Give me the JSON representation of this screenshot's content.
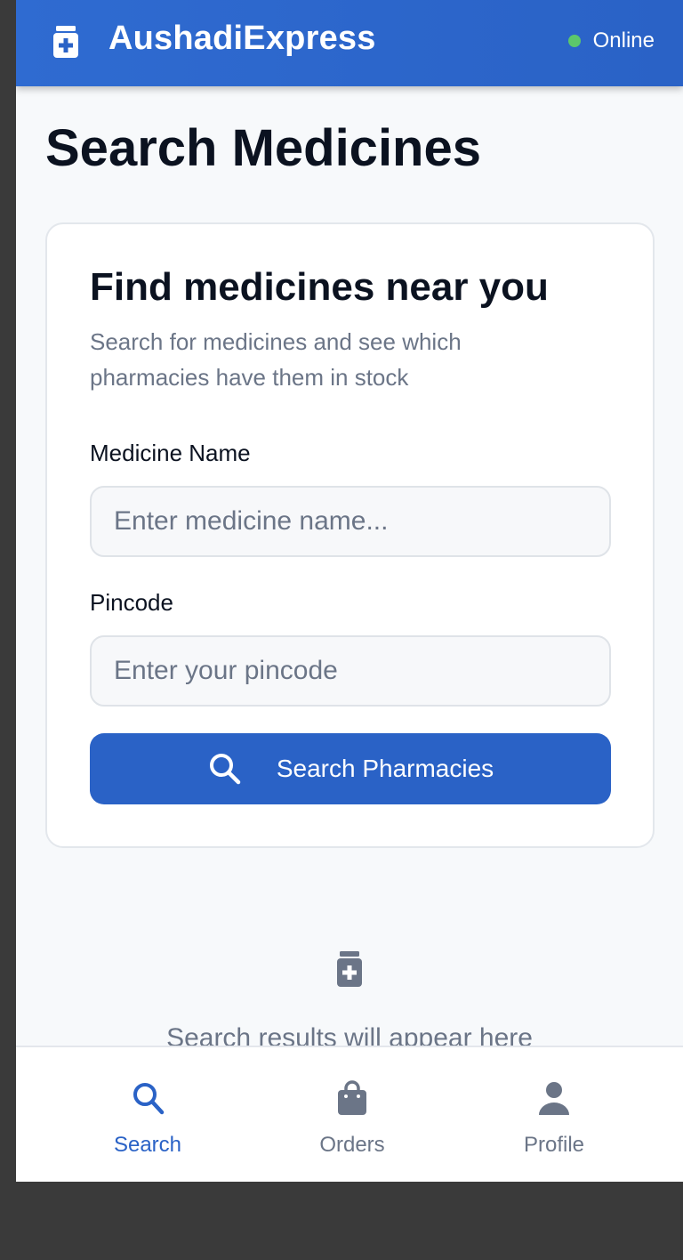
{
  "header": {
    "title": "AushadiExpress",
    "logo_icon": "medicine-bottle-plus-icon",
    "status_label": "Online",
    "status_color": "#5cc76b",
    "background": "#2a62c6"
  },
  "page": {
    "title": "Search Medicines"
  },
  "card": {
    "title": "Find medicines near you",
    "subtitle": "Search for medicines and see which pharmacies have them in stock",
    "medicine_label": "Medicine Name",
    "medicine_value": "",
    "medicine_placeholder": "Enter medicine name...",
    "pincode_label": "Pincode",
    "pincode_value": "",
    "pincode_placeholder": "Enter your pincode",
    "button_label": "Search Pharmacies",
    "button_icon": "search-icon"
  },
  "empty_state": {
    "icon": "medicine-bottle-plus-icon",
    "text": "Search results will appear here"
  },
  "bottom_nav": {
    "items": [
      {
        "label": "Search",
        "icon": "search-icon",
        "active": true
      },
      {
        "label": "Orders",
        "icon": "shopping-bag-icon",
        "active": false
      },
      {
        "label": "Profile",
        "icon": "user-icon",
        "active": false
      }
    ],
    "active_color": "#2a62c6",
    "inactive_color": "#6b7587"
  }
}
